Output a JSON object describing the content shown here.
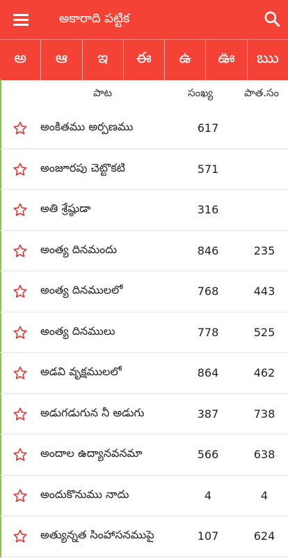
{
  "app_bar": {
    "title": "అకారాది పట్టిక",
    "menu_icon": "hamburger-menu-icon",
    "search_icon": "search-icon",
    "color": "#f44336"
  },
  "letters": [
    "అ",
    "ఆ",
    "ఇ",
    "ఈ",
    "ఉ",
    "ఊ",
    "ఋ"
  ],
  "columns": {
    "song": "పాట",
    "number": "సంఖ్య",
    "old_number": "పాత.సం"
  },
  "songs": [
    {
      "title": "అంకితము అర్పణము",
      "number": "617",
      "old_number": ""
    },
    {
      "title": "అంజూరపు చెట్టొకటి",
      "number": "571",
      "old_number": ""
    },
    {
      "title": "అతి శ్రేష్ఠుడా",
      "number": "316",
      "old_number": ""
    },
    {
      "title": "అంత్య దినమందు",
      "number": "846",
      "old_number": "235"
    },
    {
      "title": "అంత్య దినములలో",
      "number": "768",
      "old_number": "443"
    },
    {
      "title": "అంత్య దినములు",
      "number": "778",
      "old_number": "525"
    },
    {
      "title": "అడవి వృక్షములలో",
      "number": "864",
      "old_number": "462"
    },
    {
      "title": "అడుగడుగున నీ అడుగు",
      "number": "387",
      "old_number": "738"
    },
    {
      "title": "అందాల ఉద్యానవనమా",
      "number": "566",
      "old_number": "638"
    },
    {
      "title": "అందుకొనుము నాదు",
      "number": "4",
      "old_number": "4"
    },
    {
      "title": "అత్యున్నత సింహాసనముపై",
      "number": "107",
      "old_number": "624"
    }
  ],
  "favorite_icon": "star-outline-icon"
}
